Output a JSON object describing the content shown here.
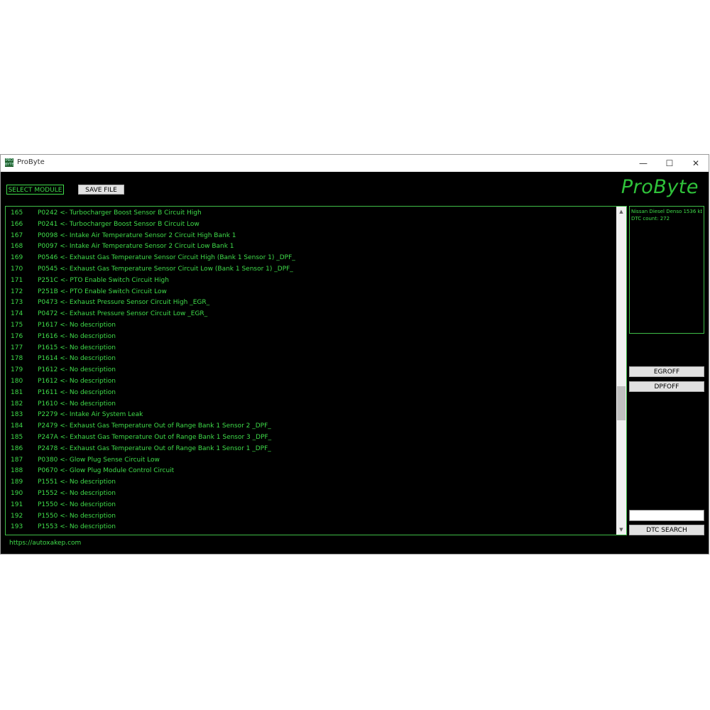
{
  "window": {
    "title": "ProByte",
    "icon_text": "PRO BYTE",
    "controls": {
      "minimize": "—",
      "maximize": "☐",
      "close": "✕"
    }
  },
  "toolbar": {
    "select_module_label": "SELECT MODULE",
    "save_file_label": "SAVE FILE"
  },
  "logo": "ProByte",
  "dtc_list": [
    {
      "num": "165",
      "text": "P0242 <- Turbocharger Boost Sensor B Circuit High"
    },
    {
      "num": "166",
      "text": "P0241 <- Turbocharger Boost Sensor B Circuit Low"
    },
    {
      "num": "167",
      "text": "P0098 <- Intake Air Temperature Sensor 2 Circuit High Bank 1"
    },
    {
      "num": "168",
      "text": "P0097 <- Intake Air Temperature Sensor 2 Circuit Low Bank 1"
    },
    {
      "num": "169",
      "text": "P0546 <- Exhaust Gas Temperature Sensor Circuit High (Bank 1 Sensor 1) _DPF_"
    },
    {
      "num": "170",
      "text": "P0545 <- Exhaust Gas Temperature Sensor Circuit Low (Bank 1 Sensor 1) _DPF_"
    },
    {
      "num": "171",
      "text": "P251C <- PTO Enable Switch Circuit High"
    },
    {
      "num": "172",
      "text": "P251B <- PTO Enable Switch Circuit Low"
    },
    {
      "num": "173",
      "text": "P0473 <- Exhaust Pressure Sensor Circuit High _EGR_"
    },
    {
      "num": "174",
      "text": "P0472 <- Exhaust Pressure Sensor Circuit Low _EGR_"
    },
    {
      "num": "175",
      "text": "P1617 <- No description"
    },
    {
      "num": "176",
      "text": "P1616 <- No description"
    },
    {
      "num": "177",
      "text": "P1615 <- No description"
    },
    {
      "num": "178",
      "text": "P1614 <- No description"
    },
    {
      "num": "179",
      "text": "P1612 <- No description"
    },
    {
      "num": "180",
      "text": "P1612 <- No description"
    },
    {
      "num": "181",
      "text": "P1611 <- No description"
    },
    {
      "num": "182",
      "text": "P1610 <- No description"
    },
    {
      "num": "183",
      "text": "P2279 <- Intake Air System Leak"
    },
    {
      "num": "184",
      "text": "P2479 <- Exhaust Gas Temperature Out of Range  Bank 1 Sensor 2 _DPF_"
    },
    {
      "num": "185",
      "text": "P247A <- Exhaust Gas Temperature Out of Range  Bank 1 Sensor 3 _DPF_"
    },
    {
      "num": "186",
      "text": "P2478 <- Exhaust Gas Temperature Out of Range  Bank 1 Sensor 1 _DPF_"
    },
    {
      "num": "187",
      "text": "P0380 <- Glow Plug Sense Circuit Low"
    },
    {
      "num": "188",
      "text": "P0670 <- Glow Plug Module Control Circuit"
    },
    {
      "num": "189",
      "text": "P1551 <- No description"
    },
    {
      "num": "190",
      "text": "P1552 <- No description"
    },
    {
      "num": "191",
      "text": "P1550 <- No description"
    },
    {
      "num": "192",
      "text": "P1550 <- No description"
    },
    {
      "num": "193",
      "text": "P1553 <- No description"
    }
  ],
  "scrollbar": {
    "up": "▲",
    "down": "▼",
    "position_fraction": 0.62
  },
  "info": {
    "line1": "Nissan Diesel Denso 1536 kb",
    "line2": "DTC count: 272"
  },
  "side_buttons": {
    "egroff": "EGROFF",
    "dpfoff": "DPFOFF",
    "dtc_search": "DTC SEARCH"
  },
  "search": {
    "value": ""
  },
  "footer": {
    "link": "https://autoxakep.com"
  },
  "colors": {
    "accent": "#3fdc4a",
    "background": "#000000"
  }
}
